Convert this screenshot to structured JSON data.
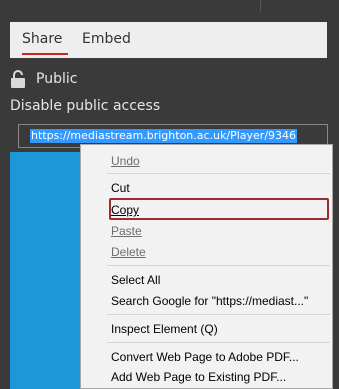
{
  "tabs": {
    "share": "Share",
    "embed": "Embed"
  },
  "access": {
    "status": "Public",
    "disable_link": "Disable public access"
  },
  "url": {
    "value": "https://mediastream.brighton.ac.uk/Player/9346"
  },
  "context_menu": {
    "undo": "Undo",
    "cut": "Cut",
    "copy": "Copy",
    "paste": "Paste",
    "delete": "Delete",
    "select_all": "Select All",
    "search": "Search Google for \"https://mediast...\"",
    "inspect": "Inspect Element (Q)",
    "convert_pdf": "Convert Web Page to Adobe PDF...",
    "add_pdf": "Add Web Page to Existing PDF..."
  },
  "colors": {
    "panel": "#3a3a3a",
    "accent_red": "#cc2222",
    "selection": "#3399ff",
    "blue_block": "#1d97d8"
  }
}
